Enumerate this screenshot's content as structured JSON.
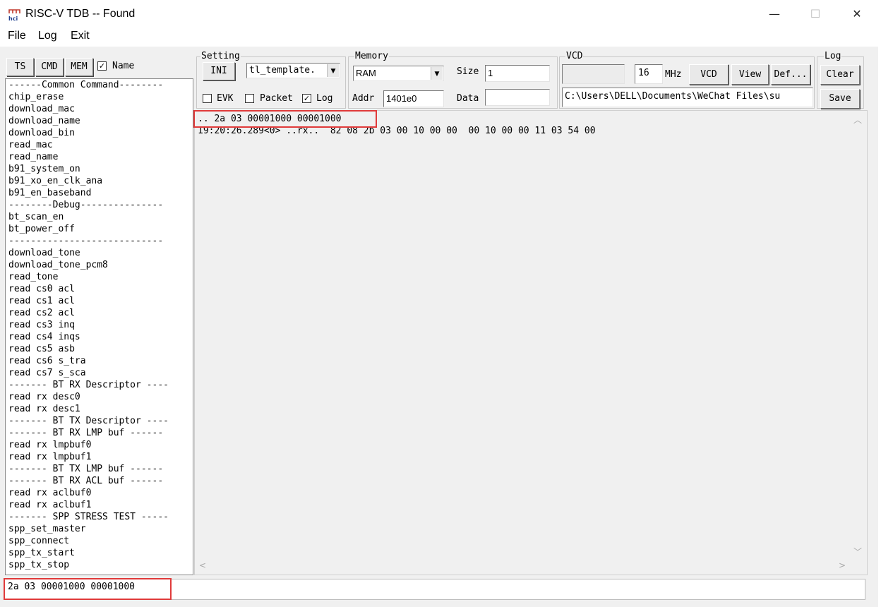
{
  "window": {
    "title": "RISC-V TDB -- Found",
    "app_icon": "hci-icon",
    "minimize_glyph": "—",
    "maximize_glyph": "☐",
    "close_glyph": "✕"
  },
  "menu": {
    "items": [
      "File",
      "Log",
      "Exit"
    ]
  },
  "left_tabs": {
    "ts": "TS",
    "cmd": "CMD",
    "mem": "MEM",
    "name_label": "Name",
    "name_checked": true
  },
  "setting": {
    "title": "Setting",
    "ini_button": "INI",
    "template_value": "tl_template.",
    "evk_label": "EVK",
    "evk_checked": false,
    "packet_label": "Packet",
    "packet_checked": false,
    "log_label": "Log",
    "log_checked": true
  },
  "memory": {
    "title": "Memory",
    "type_value": "RAM",
    "size_label": "Size",
    "size_value": "1",
    "addr_label": "Addr",
    "addr_value": "1401e0",
    "data_label": "Data",
    "data_value": ""
  },
  "vcd": {
    "title": "VCD",
    "freq_value": "16",
    "freq_unit": "MHz",
    "vcd_button": "VCD",
    "view_button": "View",
    "def_button": "Def...",
    "path_value": "C:\\Users\\DELL\\Documents\\WeChat Files\\su"
  },
  "log_group": {
    "title": "Log",
    "clear_button": "Clear",
    "save_button": "Save"
  },
  "commands": [
    "------Common Command--------",
    "chip_erase",
    "download_mac",
    "download_name",
    "download_bin",
    "read_mac",
    "read_name",
    "b91_system_on",
    "b91_xo_en_clk_ana",
    "b91_en_baseband",
    "--------Debug---------------",
    "bt_scan_en",
    "bt_power_off",
    "----------------------------",
    "download_tone",
    "download_tone_pcm8",
    "read_tone",
    "read cs0 acl",
    "read cs1 acl",
    "read cs2 acl",
    "read cs3 inq",
    "read cs4 inqs",
    "read cs5 asb",
    "read cs6 s_tra",
    "read cs7 s_sca",
    "------- BT RX Descriptor ----",
    "read rx desc0",
    "read rx desc1",
    "------- BT TX Descriptor ----",
    "------- BT RX LMP buf ------",
    "read rx lmpbuf0",
    "read rx lmpbuf1",
    "------- BT TX LMP buf ------",
    "------- BT RX ACL buf ------",
    "read rx aclbuf0",
    "read rx aclbuf1",
    "------- SPP STRESS TEST -----",
    "spp_set_master",
    "spp_connect",
    "spp_tx_start",
    "spp_tx_stop"
  ],
  "log_lines": [
    ".. 2a 03 00001000 00001000",
    "19:20:26.289<0> ..rx..  82 08 2b 03 00 10 00 00  00 10 00 00 11 03 54 00"
  ],
  "command_input": {
    "value": "2a 03 00001000 00001000"
  },
  "colors": {
    "highlight": "#e03a3a",
    "window_bg": "#f0f0f0"
  }
}
